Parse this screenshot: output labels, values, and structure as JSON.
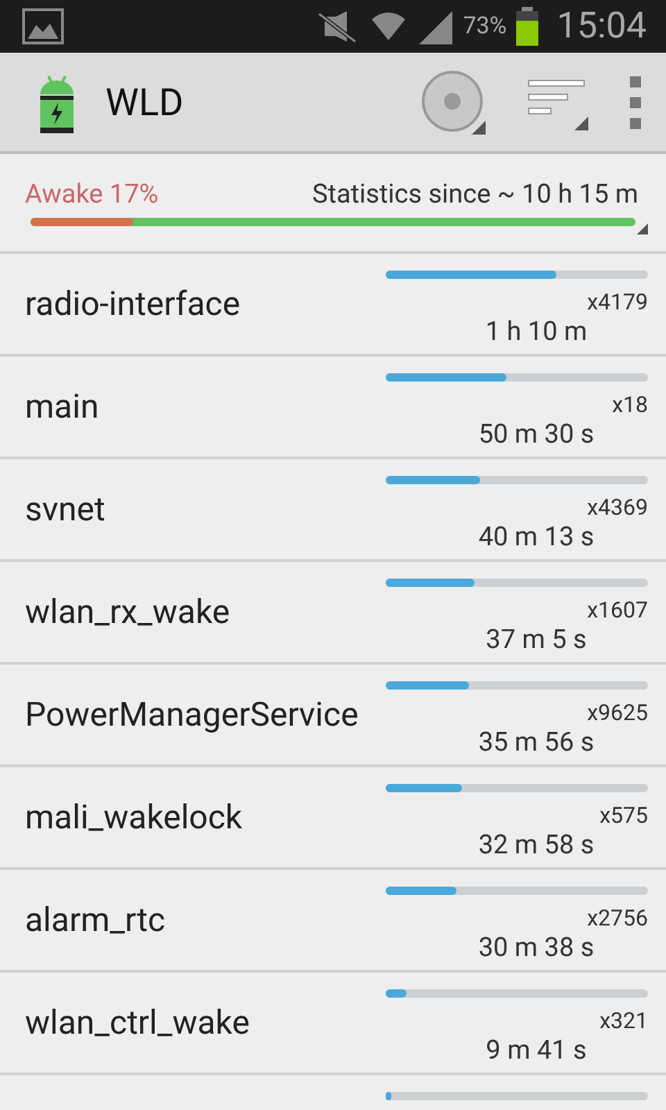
{
  "status_bar": {
    "battery_percent": "73%",
    "time": "15:04"
  },
  "app_bar": {
    "title": "WLD"
  },
  "summary": {
    "awake": "Awake 17%",
    "since": "Statistics since ~ 10 h 15 m",
    "level": 0.17
  },
  "rows": [
    {
      "name": "radio-interface",
      "count": "x4179",
      "duration": "1 h 10 m",
      "level": 0.65
    },
    {
      "name": "main",
      "count": "x18",
      "duration": "50 m 30 s",
      "level": 0.46
    },
    {
      "name": "svnet",
      "count": "x4369",
      "duration": "40 m 13 s",
      "level": 0.36
    },
    {
      "name": "wlan_rx_wake",
      "count": "x1607",
      "duration": "37 m 5 s",
      "level": 0.34
    },
    {
      "name": "PowerManagerService",
      "count": "x9625",
      "duration": "35 m 56 s",
      "level": 0.32
    },
    {
      "name": "mali_wakelock",
      "count": "x575",
      "duration": "32 m 58 s",
      "level": 0.29
    },
    {
      "name": "alarm_rtc",
      "count": "x2756",
      "duration": "30 m 38 s",
      "level": 0.27
    },
    {
      "name": "wlan_ctrl_wake",
      "count": "x321",
      "duration": "9 m 41 s",
      "level": 0.08
    },
    {
      "level": 0.02
    }
  ]
}
